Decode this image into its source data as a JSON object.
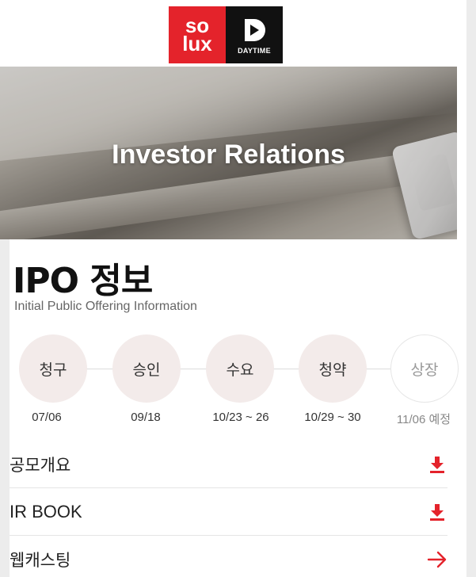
{
  "header": {
    "logo_solux_line1": "so",
    "logo_solux_line2": "lux",
    "logo_daytime": "DAYTIME"
  },
  "banner": {
    "title": "Investor Relations"
  },
  "page": {
    "title": "IPO 정보",
    "subtitle": "Initial Public Offering Information"
  },
  "steps": [
    {
      "label": "청구",
      "date": "07/06",
      "state": "done"
    },
    {
      "label": "승인",
      "date": "09/18",
      "state": "done"
    },
    {
      "label": "수요",
      "date": "10/23 ~ 26",
      "state": "done"
    },
    {
      "label": "청약",
      "date": "10/29 ~ 30",
      "state": "done"
    },
    {
      "label": "상장",
      "date": "11/06 예정",
      "state": "upcoming"
    }
  ],
  "menu": [
    {
      "label": "공모개요",
      "icon": "download-icon"
    },
    {
      "label": "IR BOOK",
      "icon": "download-icon"
    },
    {
      "label": "웹캐스팅",
      "icon": "arrow-right-icon"
    }
  ],
  "colors": {
    "accent": "#e4232b",
    "step_bg": "#f3ebea"
  }
}
